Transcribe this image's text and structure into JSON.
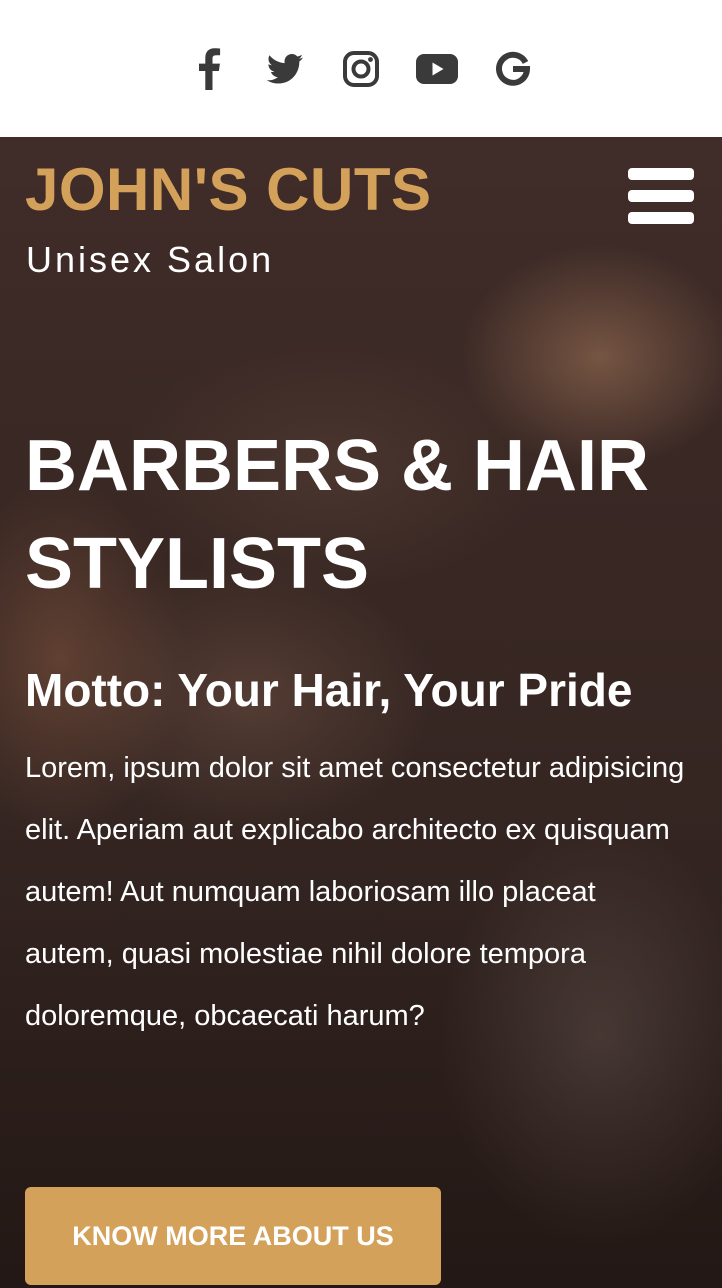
{
  "social": {
    "icons": [
      "facebook-icon",
      "twitter-icon",
      "instagram-icon",
      "youtube-icon",
      "google-icon"
    ]
  },
  "header": {
    "brand_title": "JOHN'S CUTS",
    "brand_subtitle": "Unisex Salon",
    "menu_icon": "hamburger-menu-icon"
  },
  "hero": {
    "headline": "BARBERS & HAIR STYLISTS",
    "motto": "Motto: Your Hair, Your Pride",
    "body": "Lorem, ipsum dolor sit amet consectetur adipisicing elit. Aperiam aut explicabo architecto ex quisquam autem! Aut numquam laboriosam illo placeat autem, quasi molestiae nihil dolore tempora doloremque, obcaecati harum?",
    "cta_label": "KNOW MORE ABOUT US"
  },
  "colors": {
    "accent": "#d4a15a",
    "icon": "#3a3a3a",
    "text_light": "#ffffff"
  }
}
